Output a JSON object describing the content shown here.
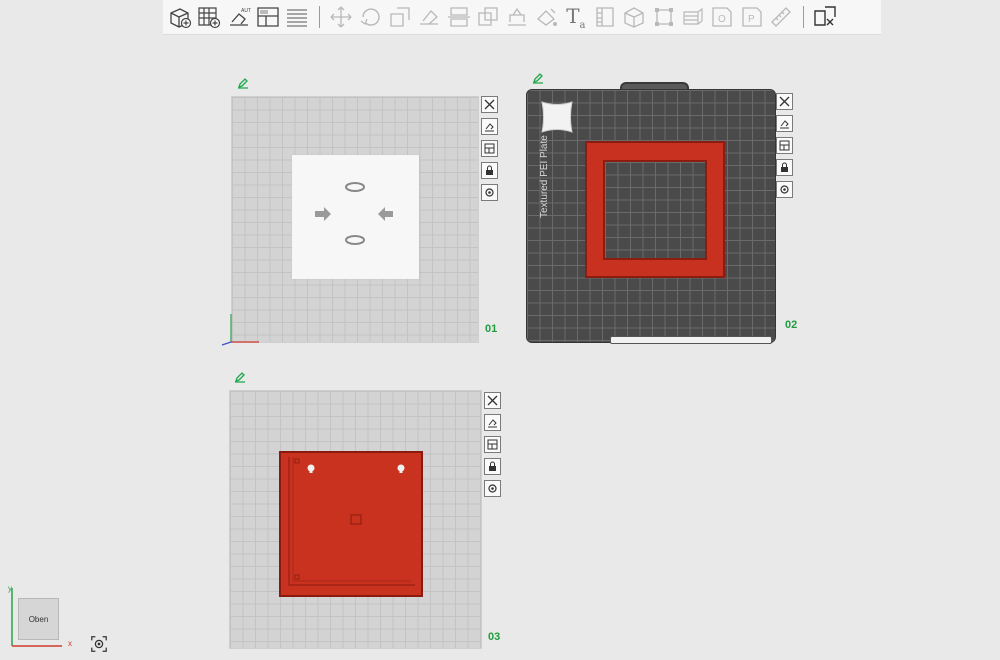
{
  "toolbar": {
    "buttons": [
      {
        "icon": "add-cube-icon",
        "enabled": true
      },
      {
        "icon": "add-plate-grid-icon",
        "enabled": true
      },
      {
        "icon": "auto-orient-icon",
        "enabled": true
      },
      {
        "icon": "arrange-icon",
        "enabled": true
      },
      {
        "icon": "layers-list-icon",
        "enabled": true
      },
      {
        "icon": "move-icon",
        "enabled": false
      },
      {
        "icon": "rotate-icon",
        "enabled": false
      },
      {
        "icon": "scale-icon",
        "enabled": false
      },
      {
        "icon": "lay-on-face-icon",
        "enabled": false
      },
      {
        "icon": "cut-icon",
        "enabled": false
      },
      {
        "icon": "boolean-icon",
        "enabled": false
      },
      {
        "icon": "support-paint-icon",
        "enabled": false
      },
      {
        "icon": "color-paint-icon",
        "enabled": false
      },
      {
        "icon": "text-icon",
        "enabled": true
      },
      {
        "icon": "variable-layer-icon",
        "enabled": false
      },
      {
        "icon": "cube-outline-icon",
        "enabled": false
      },
      {
        "icon": "measure-icon",
        "enabled": false
      },
      {
        "icon": "assembly-icon",
        "enabled": false
      },
      {
        "icon": "part-o-icon",
        "enabled": false
      },
      {
        "icon": "part-p-icon",
        "enabled": false
      },
      {
        "icon": "ruler-icon",
        "enabled": false
      },
      {
        "icon": "split-view-icon",
        "enabled": true
      }
    ],
    "text_tool": {
      "main": "T",
      "sub": "a"
    }
  },
  "plates": [
    {
      "number": "01",
      "bed": "light"
    },
    {
      "number": "02",
      "bed": "dark",
      "label": "Textured PEI Plate"
    },
    {
      "number": "03",
      "bed": "light"
    }
  ],
  "view_cube": {
    "face_label": "Oben",
    "axis_y": "y",
    "axis_x": "x"
  },
  "colors": {
    "model_red": "#c8311f",
    "plate_number_green": "#1f9d3f",
    "edit_icon_green": "#1fa84a"
  }
}
